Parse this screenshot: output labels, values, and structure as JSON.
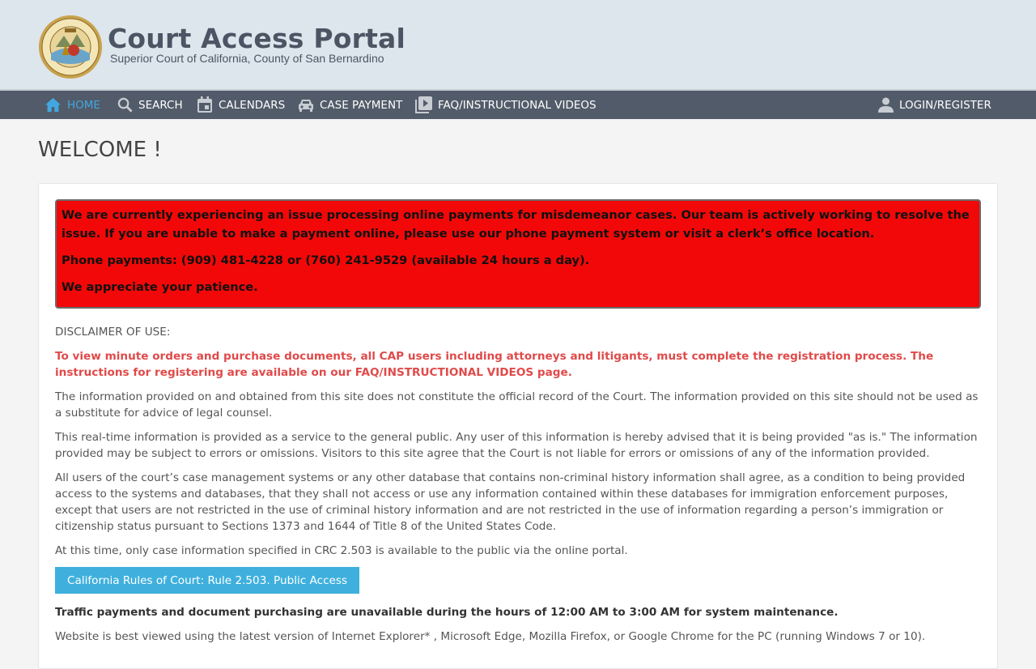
{
  "header": {
    "title": "Court Access Portal",
    "subtitle": "Superior Court of California, County of San Bernardino",
    "seal_icon": "california-court-seal"
  },
  "nav": {
    "items": [
      {
        "label": "HOME",
        "icon": "home-icon",
        "active": true
      },
      {
        "label": "SEARCH",
        "icon": "search-icon"
      },
      {
        "label": "CALENDARS",
        "icon": "calendar-icon"
      },
      {
        "label": "CASE PAYMENT",
        "icon": "car-icon"
      },
      {
        "label": "FAQ/INSTRUCTIONAL VIDEOS",
        "icon": "video-icon"
      }
    ],
    "login": {
      "label": "LOGIN/REGISTER",
      "icon": "user-icon"
    },
    "colors": {
      "bar": "#525b69",
      "active": "#42a7e0"
    }
  },
  "main": {
    "title": "WELCOME !",
    "alert": {
      "line1": "We are currently experiencing an issue processing online payments for misdemeanor cases. Our team is actively working to resolve the issue. If you are unable to make a payment online, please use our phone payment system or visit a clerk’s office location.",
      "line2": "Phone payments: (909) 481-4228 or (760) 241-9529 (available 24 hours a day).",
      "line3": "We appreciate your patience.",
      "color": "#f20808"
    },
    "disclaimer_heading": "DISCLAIMER OF USE:",
    "registration_notice": "To view minute orders and purchase documents, all CAP users including attorneys and litigants, must complete the registration process. The instructions for registering are available on our FAQ/INSTRUCTIONAL VIDEOS page.",
    "para1": "The information provided on and obtained from this site does not constitute the official record of the Court. The information provided on this site should not be used as a substitute for advice of legal counsel.",
    "para2": "This real-time information is provided as a service to the general public. Any user of this information is hereby advised that it is being provided \"as is.\" The information provided may be subject to errors or omissions. Visitors to this site agree that the Court is not liable for errors or omissions of any of the information provided.",
    "para3": "All users of the court’s case management systems or any other database that contains non-criminal history information shall agree, as a condition to being provided access to the systems and databases, that they shall not access or use any information contained within these databases for immigration enforcement purposes, except that users are not restricted in the use of criminal history information and are not restricted in the use of information regarding a person’s immigration or citizenship status pursuant to Sections 1373 and 1644 of Title 8 of the United States Code.",
    "para4": "At this time, only case information specified in CRC 2.503 is available to the public via the online portal.",
    "rule_button": "California Rules of Court: Rule 2.503. Public Access",
    "maintenance_notice": "Traffic payments and document purchasing are unavailable during the hours of 12:00 AM to 3:00 AM for system maintenance.",
    "browser_notice": "Website is best viewed using the latest version of Internet Explorer* , Microsoft Edge, Mozilla Firefox, or Google Chrome for the PC (running Windows 7 or 10)."
  }
}
